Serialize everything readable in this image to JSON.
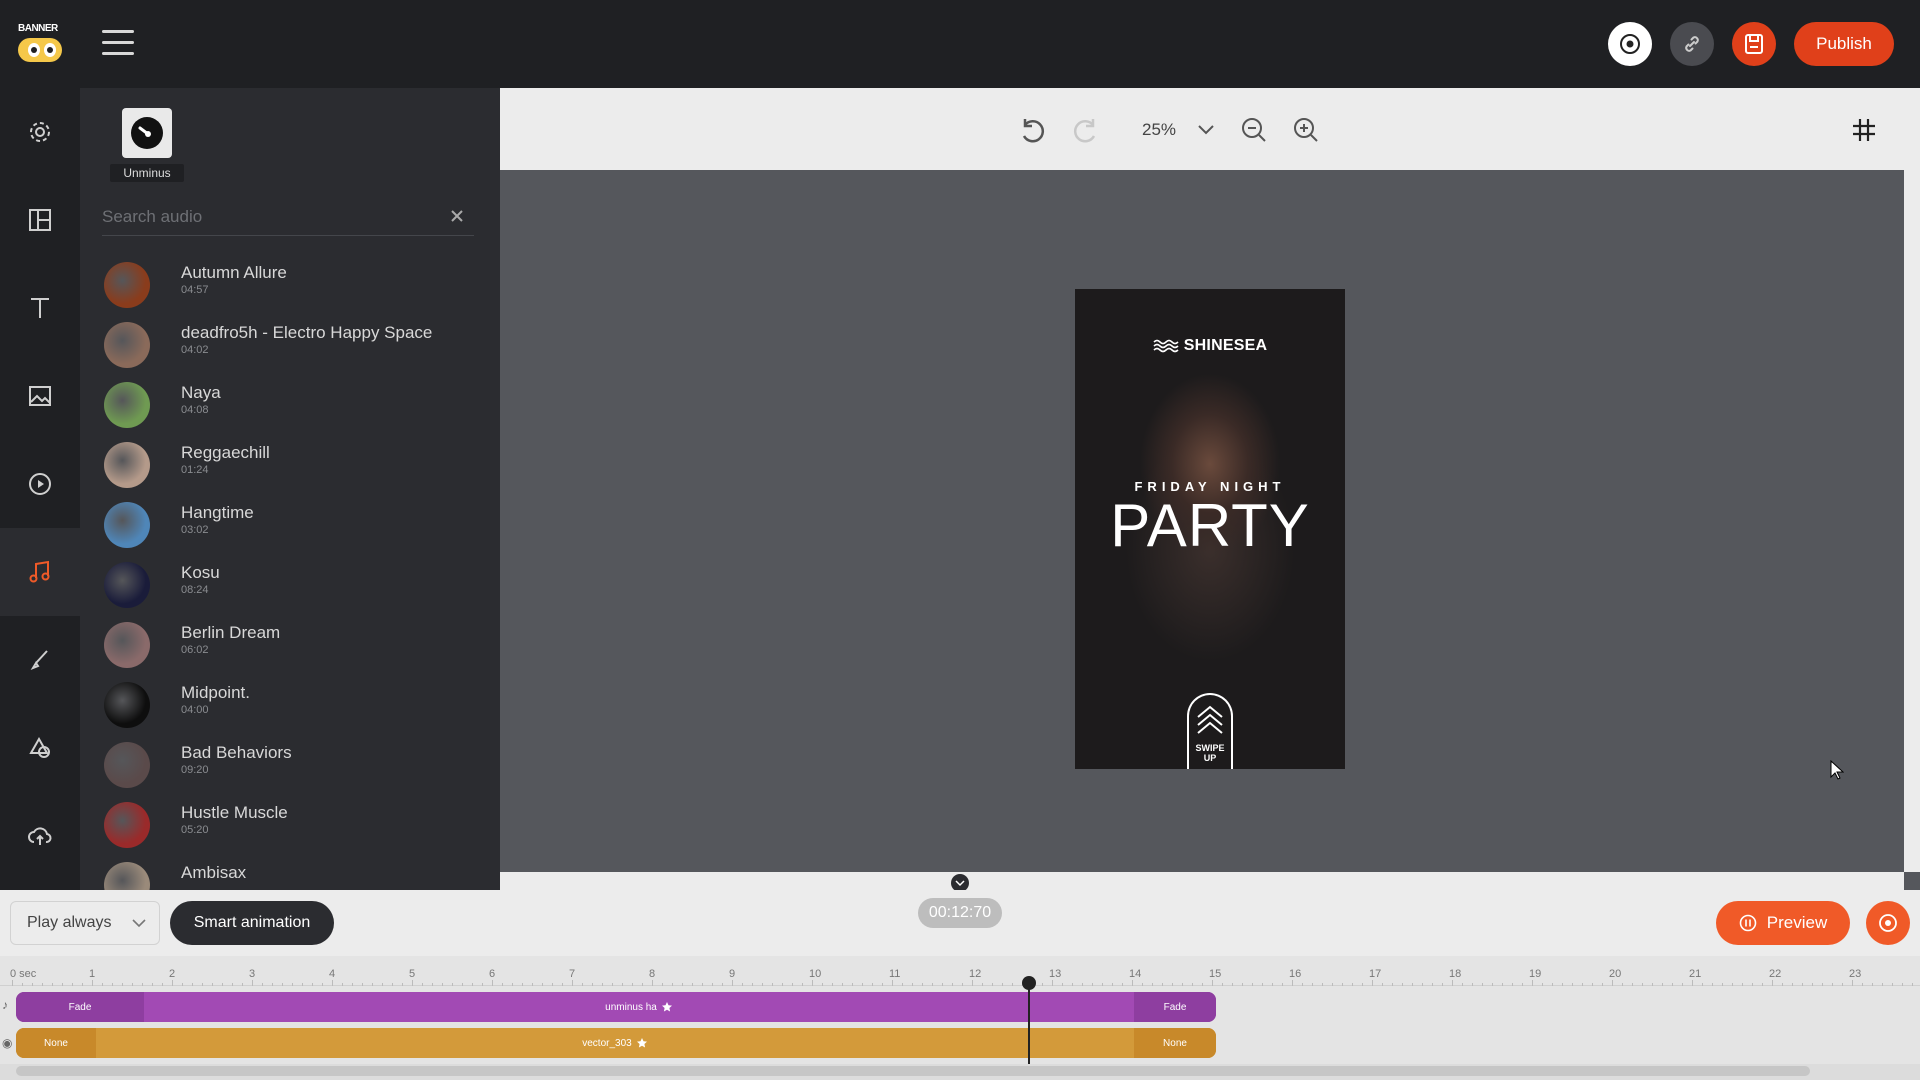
{
  "app": {
    "logo_text_line1": "BANNER",
    "logo_text_line2": "BOO"
  },
  "header": {
    "publish_label": "Publish"
  },
  "rail": {
    "items": [
      {
        "icon": "gear-icon"
      },
      {
        "icon": "layout-icon"
      },
      {
        "icon": "text-icon"
      },
      {
        "icon": "image-icon"
      },
      {
        "icon": "video-icon"
      },
      {
        "icon": "music-icon",
        "active": true
      },
      {
        "icon": "brush-icon"
      },
      {
        "icon": "shapes-icon"
      },
      {
        "icon": "upload-icon"
      }
    ]
  },
  "audio_panel": {
    "source_label": "Unminus",
    "search_placeholder": "Search audio",
    "tracks": [
      {
        "title": "Autumn Allure",
        "duration": "04:57",
        "color": "#8a3c1c"
      },
      {
        "title": "deadfro5h - Electro Happy Space",
        "duration": "04:02",
        "color": "#8a6a5a"
      },
      {
        "title": "Naya",
        "duration": "04:08",
        "color": "#6f9a52"
      },
      {
        "title": "Reggaechill",
        "duration": "01:24",
        "color": "#b49a8a"
      },
      {
        "title": "Hangtime",
        "duration": "03:02",
        "color": "#4f86b8"
      },
      {
        "title": "Kosu",
        "duration": "08:24",
        "color": "#1a1c3a"
      },
      {
        "title": "Berlin Dream",
        "duration": "06:02",
        "color": "#8a6a6a"
      },
      {
        "title": "Midpoint.",
        "duration": "04:00",
        "color": "#0e0e0e"
      },
      {
        "title": "Bad Behaviors",
        "duration": "09:20",
        "color": "#5a4a4a"
      },
      {
        "title": "Hustle Muscle",
        "duration": "05:20",
        "color": "#9a2a2a"
      },
      {
        "title": "Ambisax",
        "duration": "",
        "color": "#9a8a7a"
      }
    ]
  },
  "canvas": {
    "zoom": "25%"
  },
  "artboard": {
    "brand": "SHINESEA",
    "subtitle": "FRIDAY NIGHT",
    "title": "PARTY",
    "swipe_line1": "SWIPE",
    "swipe_line2": "UP"
  },
  "controls": {
    "play_mode": "Play always",
    "smart_animation_label": "Smart animation",
    "current_time": "00:12:70",
    "preview_label": "Preview"
  },
  "timeline": {
    "ruler_start_label": "0 sec",
    "ticks": [
      "1",
      "2",
      "3",
      "4",
      "5",
      "6",
      "7",
      "8",
      "9",
      "10",
      "11",
      "12",
      "13",
      "14",
      "15",
      "16",
      "17",
      "18",
      "19",
      "20",
      "21",
      "22",
      "23"
    ],
    "audio_track": {
      "in_label": "Fade",
      "name": "unminus ha",
      "out_label": "Fade",
      "color": "#a24ab4"
    },
    "visual_track": {
      "in_label": "None",
      "name": "vector_303",
      "out_label": "None",
      "color": "#d39a3a"
    }
  }
}
